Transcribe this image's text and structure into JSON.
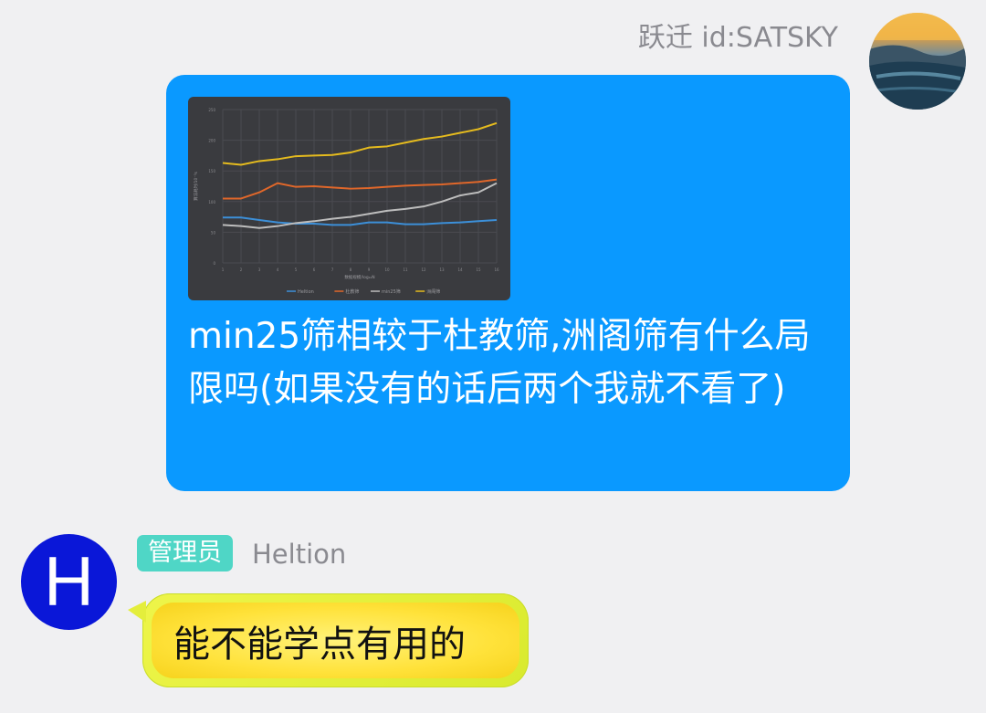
{
  "messages": [
    {
      "sender": "跃迁 id:SATSKY",
      "text": "min25筛相较于杜教筛,洲阁筛有什么局限吗(如果没有的话后两个我就不看了)",
      "image": {
        "chart_data": {
          "type": "line",
          "title": "",
          "xlabel": "数据规模/log₁₀N",
          "ylabel": "算法耗时/10⁻³s",
          "ylim": [
            0,
            250
          ],
          "x": [
            1,
            2,
            3,
            4,
            5,
            6,
            7,
            8,
            9,
            10,
            11,
            12,
            13,
            14,
            15,
            16
          ],
          "series": [
            {
              "name": "Heltion",
              "color": "#3c8fd8",
              "values": [
                74,
                74,
                70,
                66,
                64,
                64,
                62,
                62,
                66,
                66,
                63,
                63,
                65,
                66,
                68,
                70
              ]
            },
            {
              "name": "杜教筛",
              "color": "#e0672a",
              "values": [
                105,
                105,
                115,
                130,
                124,
                125,
                123,
                121,
                122,
                124,
                126,
                127,
                128,
                130,
                132,
                136
              ]
            },
            {
              "name": "min25筛",
              "color": "#bdbdbd",
              "values": [
                62,
                60,
                57,
                60,
                65,
                68,
                72,
                75,
                80,
                85,
                88,
                92,
                100,
                110,
                115,
                130
              ]
            },
            {
              "name": "洲阁筛",
              "color": "#e5bb1e",
              "values": [
                163,
                160,
                166,
                169,
                174,
                175,
                176,
                180,
                188,
                190,
                196,
                202,
                206,
                212,
                218,
                228
              ]
            }
          ]
        }
      }
    },
    {
      "badge": "管理员",
      "sender": "Heltion",
      "avatar_letter": "H",
      "text": "能不能学点有用的"
    }
  ],
  "colors": {
    "background": "#f0f0f2",
    "outgoing_bubble": "#0a99ff",
    "admin_badge": "#4fd6c6",
    "incoming_bubble": "#ffe23a",
    "avatar_h": "#0a17d8"
  },
  "icons": [
    "profile-photo-avatar",
    "letter-avatar"
  ]
}
